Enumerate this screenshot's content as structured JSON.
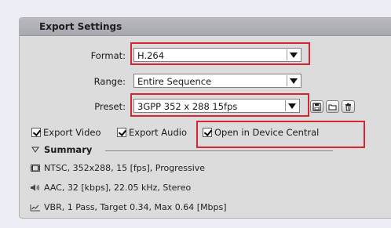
{
  "panel": {
    "title": "Export Settings"
  },
  "format": {
    "label": "Format:",
    "value": "H.264"
  },
  "range": {
    "label": "Range:",
    "value": "Entire Sequence"
  },
  "preset": {
    "label": "Preset:",
    "value": "3GPP 352 x 288 15fps"
  },
  "checkboxes": {
    "export_video": {
      "label": "Export Video",
      "checked": true
    },
    "export_audio": {
      "label": "Export Audio",
      "checked": true
    },
    "open_device_central": {
      "label": "Open in Device Central",
      "checked": true
    }
  },
  "summary": {
    "title": "Summary",
    "video": "NTSC, 352x288, 15 [fps], Progressive",
    "audio": "AAC, 32 [kbps], 22.05 kHz, Stereo",
    "bitrate": "VBR, 1 Pass, Target 0.34, Max 0.64 [Mbps]"
  },
  "icons": {
    "save_preset": "save-icon",
    "import_preset": "folder-icon",
    "delete_preset": "trash-icon",
    "summary_toggle": "triangle-down-icon"
  },
  "colors": {
    "highlight_box": "#d32632"
  }
}
